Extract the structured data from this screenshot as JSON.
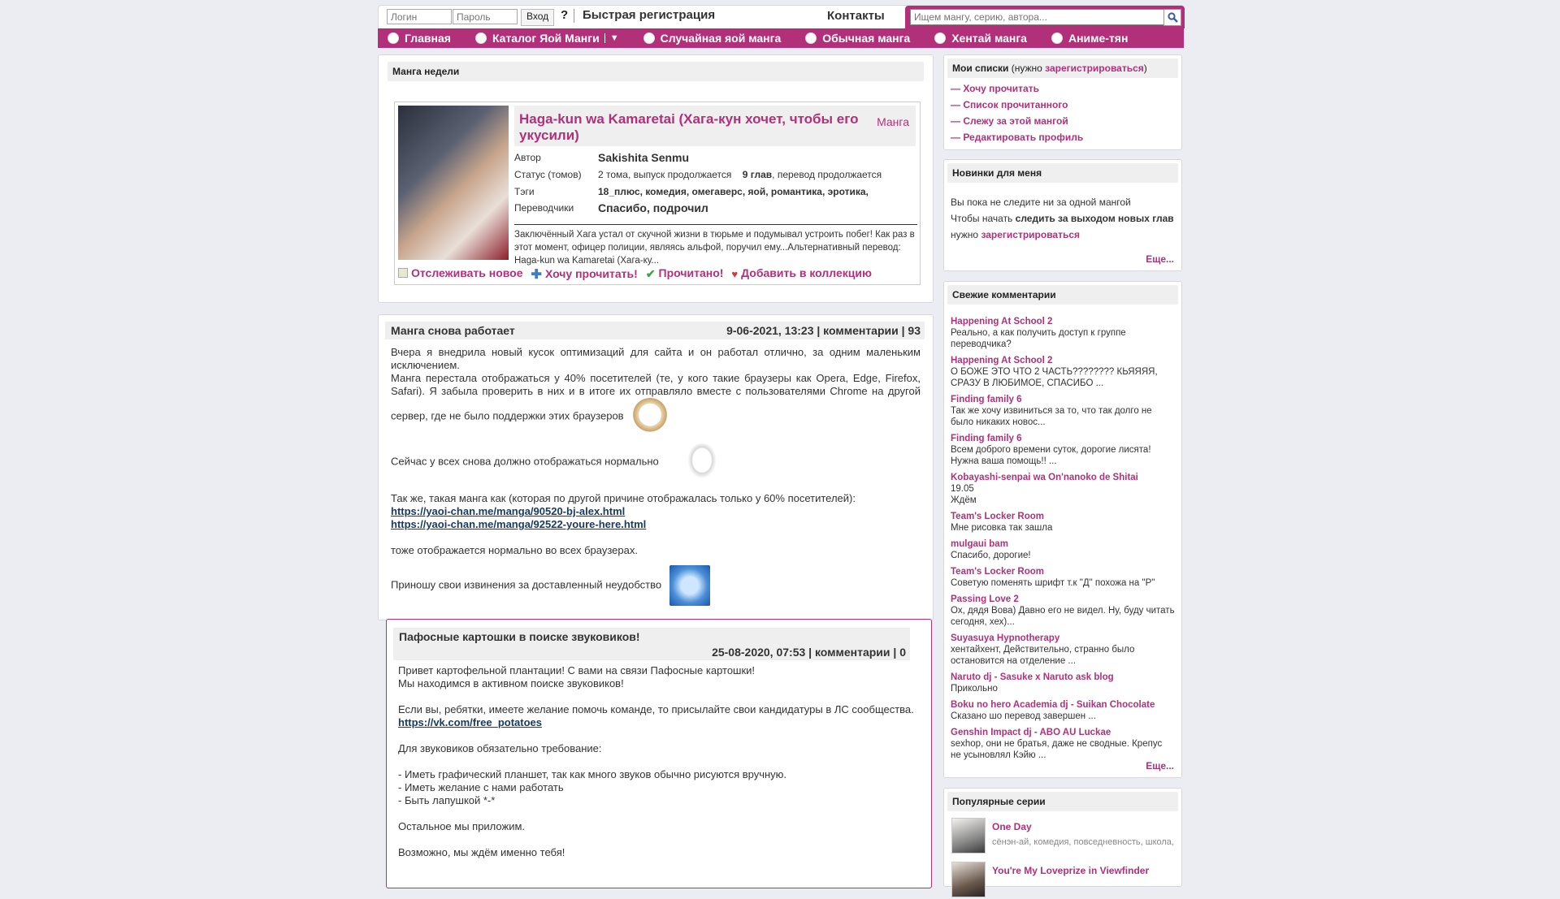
{
  "header": {
    "login_placeholder": "Логин",
    "password_placeholder": "Пароль",
    "login_button": "Вход",
    "help": "?",
    "register": "Быстрая регистрация",
    "contacts": "Контакты",
    "search_placeholder": "Ищем мангу, серию, автора..."
  },
  "nav": [
    {
      "label": "Главная"
    },
    {
      "label": "Каталог Яой Манги",
      "dropdown": "▼"
    },
    {
      "label": "Случайная яой манга"
    },
    {
      "label": "Обычная манга"
    },
    {
      "label": "Хентай манга"
    },
    {
      "label": "Аниме-тян"
    }
  ],
  "weekly": {
    "title": "Манга недели",
    "manga_title": "Haga-kun wa Kamaretai (Хага-кун хочет, чтобы его укусили)",
    "manga_type": "Манга",
    "author_label": "Автор",
    "author": "Sakishita Senmu",
    "status_label": "Статус (томов)",
    "status": "2 тома, выпуск продолжается",
    "chapters": "9 глав",
    "translation_status": ", перевод продолжается",
    "tags_label": "Тэги",
    "tags": "18_плюс, комедия, омегаверс, яой, романтика, эротика,",
    "translators_label": "Переводчики",
    "translators": "Спасибо, подрочил",
    "description": "Заключённый Хага устал от скучной жизни в тюрьме и подумывал устроить побег! Как раз в этот момент, офицер полиции, являясь альфой, поручил ему...Альтернативный перевод: Haga-kun wa Kamaretai (Хага-ку...",
    "action_track": "Отслеживать новое",
    "action_want": "Хочу прочитать!",
    "action_read": "Прочитано!",
    "action_collection": "Добавить в коллекцию"
  },
  "news": [
    {
      "title": "Манга снова работает",
      "meta": "9-06-2021, 13:23 | комментарии | 93",
      "p1": "Вчера я внедрила новый кусок оптимизаций для сайта и он работал отлично, за одним маленьким исключением.",
      "p2": "Манга перестала отображаться у 40% посетителей (те, у кого такие браузеры как Opera, Edge, Firefox, Safari). Я забыла проверить в них и в итоге их отправляло вместе с пользователями Chrome на другой сервер, где не было поддержки этих браузеров",
      "p3": "Сейчас у всех снова должно отображаться нормально",
      "p4": "Так же, такая манга как (которая по другой причине отображалась только у 60% посетителей):",
      "link1": "https://yaoi-chan.me/manga/90520-bj-alex.html",
      "link2": "https://yaoi-chan.me/manga/92522-youre-here.html",
      "p5": "тоже отображается нормально во всех браузерах.",
      "p6": "Приношу свои извинения за доставленный неудобство"
    },
    {
      "title": "Пафосные картошки в поиске звуковиков!",
      "meta": "25-08-2020, 07:53 | комментарии | 0",
      "p1": "Привет картофельной плантации! С вами на связи Пафосные картошки!",
      "p2": "Мы находимся в активном поиске звуковиков!",
      "p3": "Если вы, ребятки, имеете желание помочь команде, то присылайте свои кандидатуры в ЛС сообщества.",
      "link": "https://vk.com/free_potatoes",
      "p4": "Для звуковиков обязательно требование:",
      "p5": "- Иметь графический планшет, так как много звуков обычно рисуются вручную.",
      "p6": "- Иметь желание с нами работать",
      "p7": "- Быть лапушкой *-*",
      "p8": "Остальное мы приложим.",
      "p9": "Возможно, мы ждём именно тебя!"
    }
  ],
  "sidebar": {
    "lists_title": "Мои списки",
    "lists_note_open": "(нужно ",
    "lists_note_link": "зарегистрироваться",
    "lists_note_close": ")",
    "lists": [
      "— Хочу прочитать",
      "— Список прочитанного",
      "— Слежу за этой мангой",
      "— Редактировать профиль"
    ],
    "new_title": "Новинки для меня",
    "new_line1": "Вы пока не следите ни за одной мангой",
    "new_line2_a": "Чтобы начать ",
    "new_line2_b": "следить за выходом новых глав",
    "new_line3_a": "нужно ",
    "new_line3_b": "зарегистрироваться",
    "more": "Еще...",
    "comments_title": "Свежие комментарии",
    "comments": [
      {
        "title": "Happening At School 2",
        "text": "Реально, а как получить доступ к группе переводчика?"
      },
      {
        "title": "Happening At School 2",
        "text": "О БОЖЕ ЭТО ЧТО 2 ЧАСТЬ???????? КЬЯЯЯЯ, СРАЗУ В ЛЮБИМОЕ, СПАСИБО ..."
      },
      {
        "title": "Finding family 6",
        "text": "Так же хочу извиниться за то, что так долго не было никаких новос..."
      },
      {
        "title": "Finding family 6",
        "text": "Всем доброго времени суток, дорогие лисята! Нужна ваша помощь!! ..."
      },
      {
        "title": "Kobayashi-senpai wa On'nanoko de Shitai",
        "text": "19.05\nЖдём"
      },
      {
        "title": "Team's Locker Room",
        "text": "Мне рисовка так зашла"
      },
      {
        "title": "mulgaui bam",
        "text": "Спасибо, дорогие!"
      },
      {
        "title": "Team's Locker Room",
        "text": "Советую поменять шрифт т.к \"Д\" похожа на \"Р\""
      },
      {
        "title": "Passing Love 2",
        "text": "Ох, дядя Вова) Давно его не видел. Ну, буду читать сегодня, хех)..."
      },
      {
        "title": "Suyasuya Hypnotherapy",
        "text": "хентайхент, Действительно, странно было остановится на отделение ..."
      },
      {
        "title": "Naruto dj - Sasuke x Naruto ask blog",
        "text": "Прикольно"
      },
      {
        "title": "Boku no hero Academia dj - Suikan Chocolate",
        "text": "Сказано шо перевод завершен ..."
      },
      {
        "title": "Genshin Impact dj - ABO AU Luckae",
        "text": "sexhop, они не братья, даже не сводные. Крепус не усыновлял Кэйю ..."
      }
    ],
    "popular_title": "Популярные серии",
    "popular": [
      {
        "name": "One Day",
        "tags": "сёнэн-ай, комедия, повседневность, школа,"
      },
      {
        "name": "You're My Loveprize in Viewfinder",
        "tags": ""
      }
    ]
  }
}
